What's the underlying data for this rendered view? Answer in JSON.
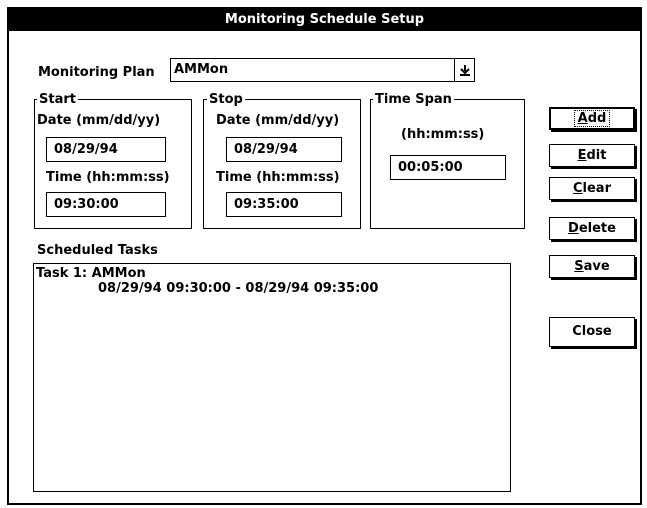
{
  "window": {
    "title": "Monitoring Schedule Setup"
  },
  "plan": {
    "label": "Monitoring Plan",
    "value": "AMMon"
  },
  "start": {
    "group_title": "Start",
    "date_label": "Date (mm/dd/yy)",
    "date_value": "08/29/94",
    "time_label": "Time (hh:mm:ss)",
    "time_value": "09:30:00"
  },
  "stop": {
    "group_title": "Stop",
    "date_label": "Date (mm/dd/yy)",
    "date_value": "08/29/94",
    "time_label": "Time (hh:mm:ss)",
    "time_value": "09:35:00"
  },
  "timespan": {
    "group_title": "Time Span",
    "label": "(hh:mm:ss)",
    "value": "00:05:00"
  },
  "buttons": {
    "add": {
      "mnemonic": "A",
      "rest": "dd"
    },
    "edit": {
      "mnemonic": "E",
      "rest": "dit"
    },
    "clear": {
      "mnemonic": "C",
      "rest": "lear"
    },
    "delete": {
      "mnemonic": "D",
      "rest": "elete"
    },
    "save": {
      "mnemonic": "S",
      "rest": "ave"
    },
    "close": {
      "label": "Close"
    }
  },
  "tasks": {
    "label": "Scheduled Tasks",
    "items": [
      {
        "line1": "Task 1: AMMon",
        "line2": "08/29/94 09:30:00 - 08/29/94 09:35:00"
      }
    ]
  }
}
